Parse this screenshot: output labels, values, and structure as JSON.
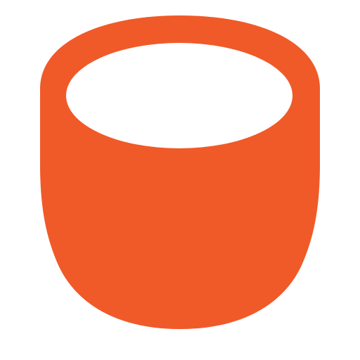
{
  "icon": {
    "name": "cup-icon",
    "colors": {
      "fill": "#F05A28",
      "opening": "#FFFFFF",
      "background": "#FFFFFF"
    }
  }
}
